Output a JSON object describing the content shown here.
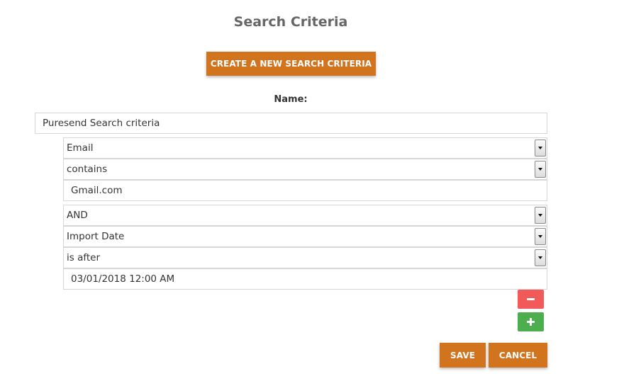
{
  "page": {
    "title": "Search Criteria",
    "create_button_label": "CREATE A NEW SEARCH CRITERIA",
    "name_label": "Name:",
    "name_value": "Puresend Search criteria"
  },
  "criteria": [
    {
      "field": "Email",
      "operator": "contains",
      "value": "Gmail.com"
    },
    {
      "join": "AND",
      "field": "Import Date",
      "operator": "is after",
      "value": "03/01/2018 12:00 AM"
    }
  ],
  "actions": {
    "remove_icon": "minus-icon",
    "add_icon": "plus-icon",
    "save_label": "SAVE",
    "cancel_label": "CANCEL"
  },
  "colors": {
    "accent": "#d2731d",
    "remove": "#f25a5a",
    "add": "#4cae4c"
  }
}
